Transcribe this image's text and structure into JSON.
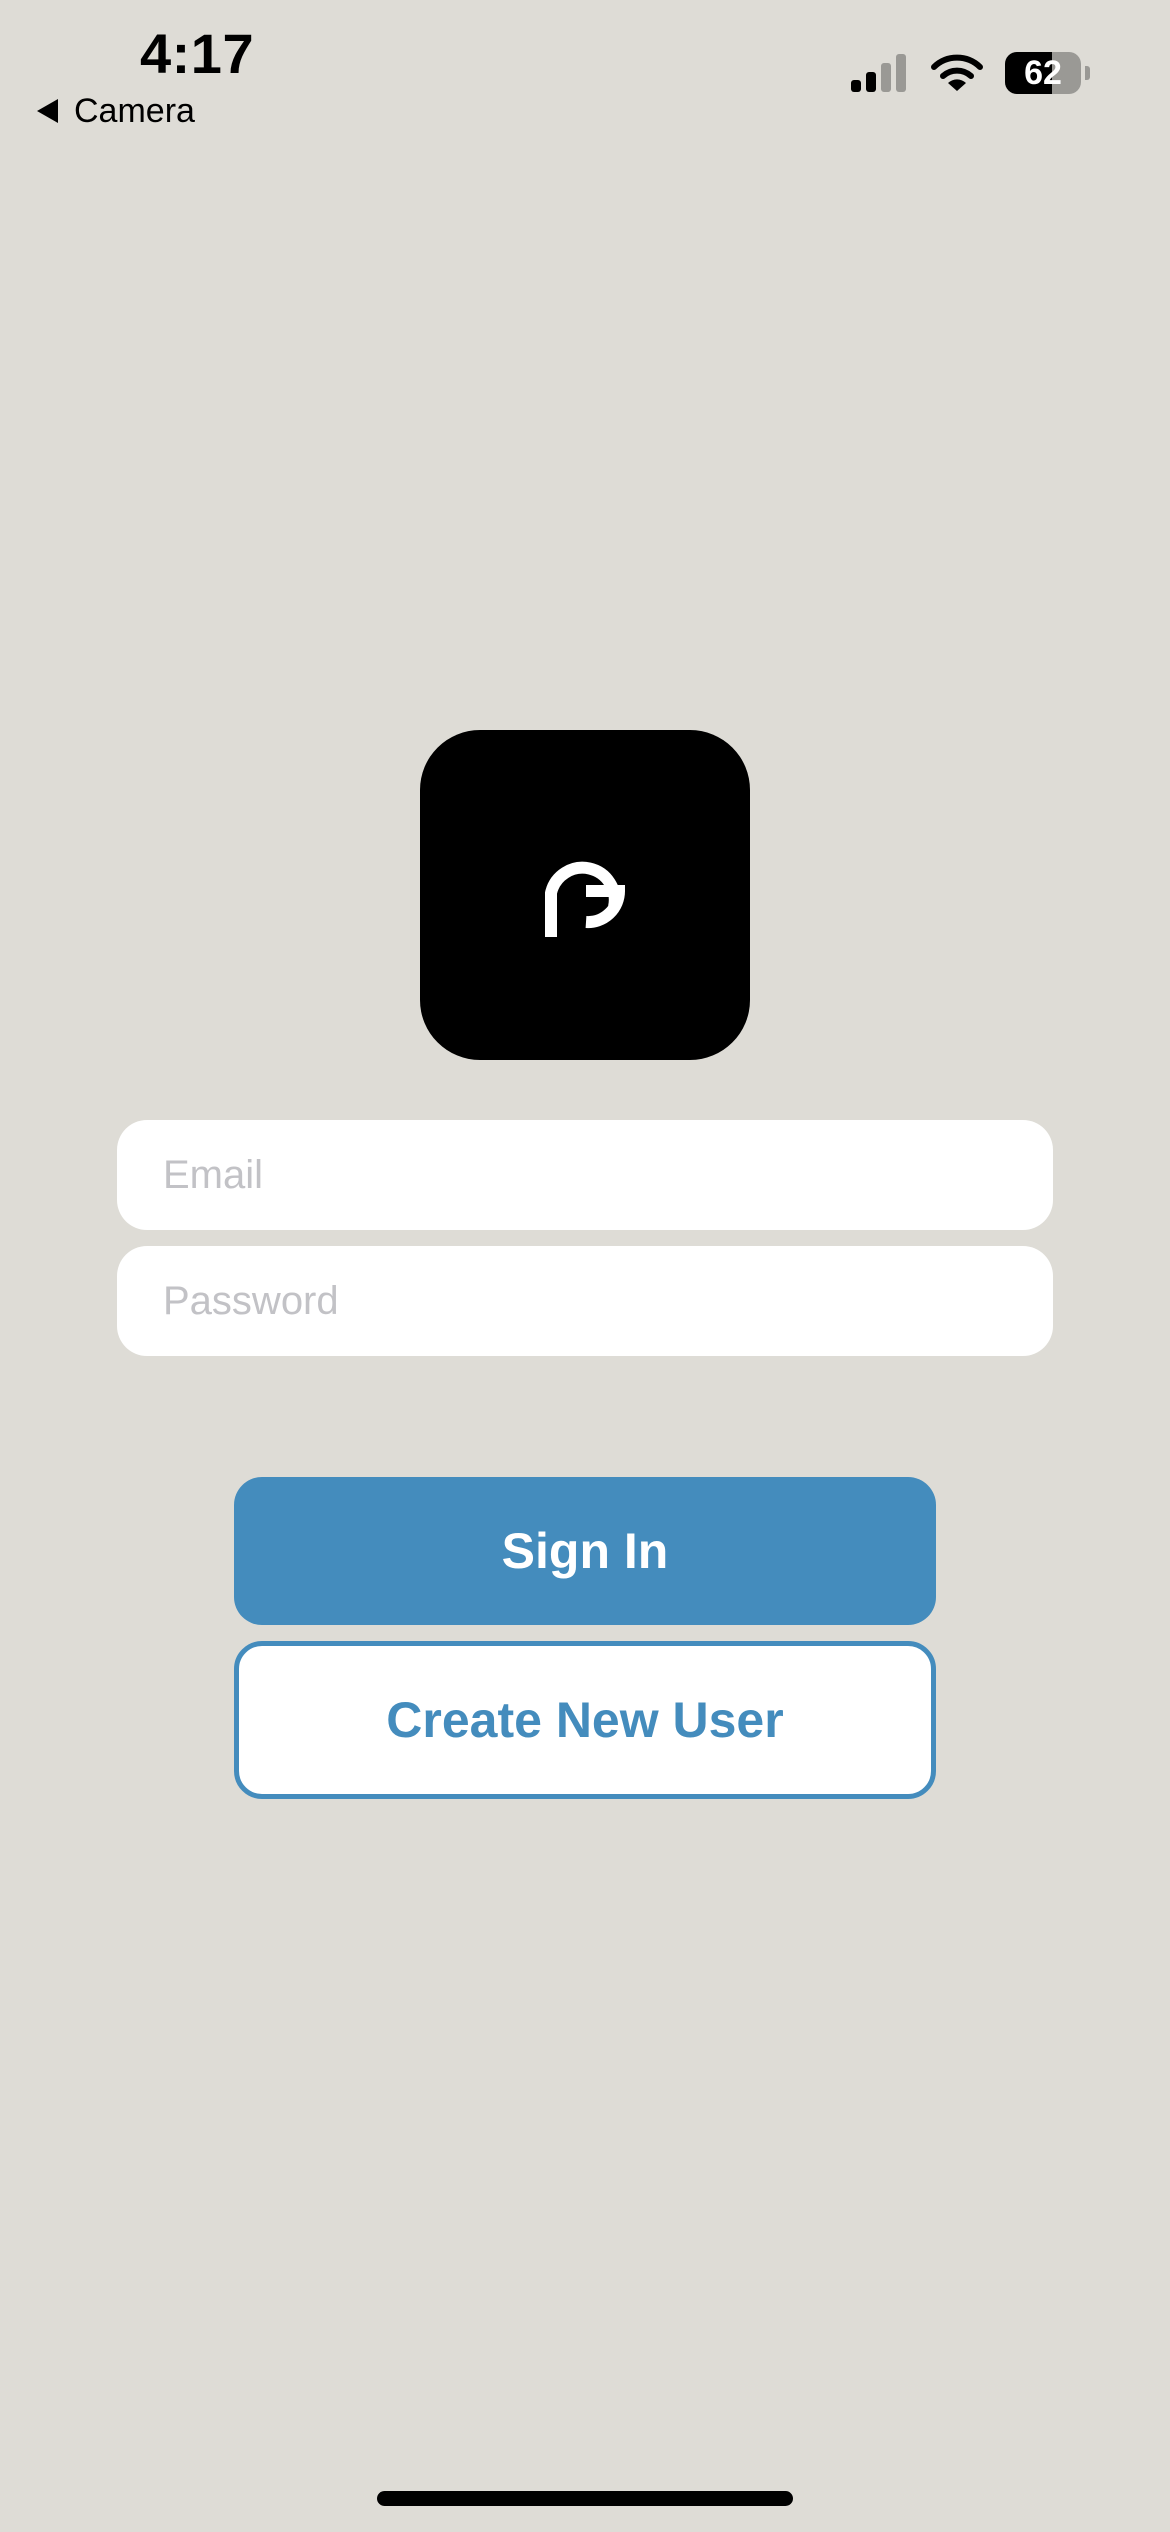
{
  "status_bar": {
    "time": "4:17",
    "back_label": "Camera",
    "back_icon": "back-triangle-icon",
    "signal_icon": "cellular-signal-icon",
    "signal_bars_active": 2,
    "signal_bars_total": 4,
    "wifi_icon": "wifi-icon",
    "battery_icon": "battery-icon",
    "battery_level": "62",
    "battery_fraction": 0.62
  },
  "logo": {
    "icon": "app-logo-icon",
    "background": "#000000"
  },
  "form": {
    "email": {
      "placeholder": "Email",
      "value": ""
    },
    "password": {
      "placeholder": "Password",
      "value": ""
    }
  },
  "actions": {
    "sign_in_label": "Sign In",
    "create_user_label": "Create New User"
  },
  "colors": {
    "background": "#dedcd6",
    "accent": "#448cbd",
    "field_background": "#ffffff",
    "placeholder": "#c2c2c6"
  }
}
